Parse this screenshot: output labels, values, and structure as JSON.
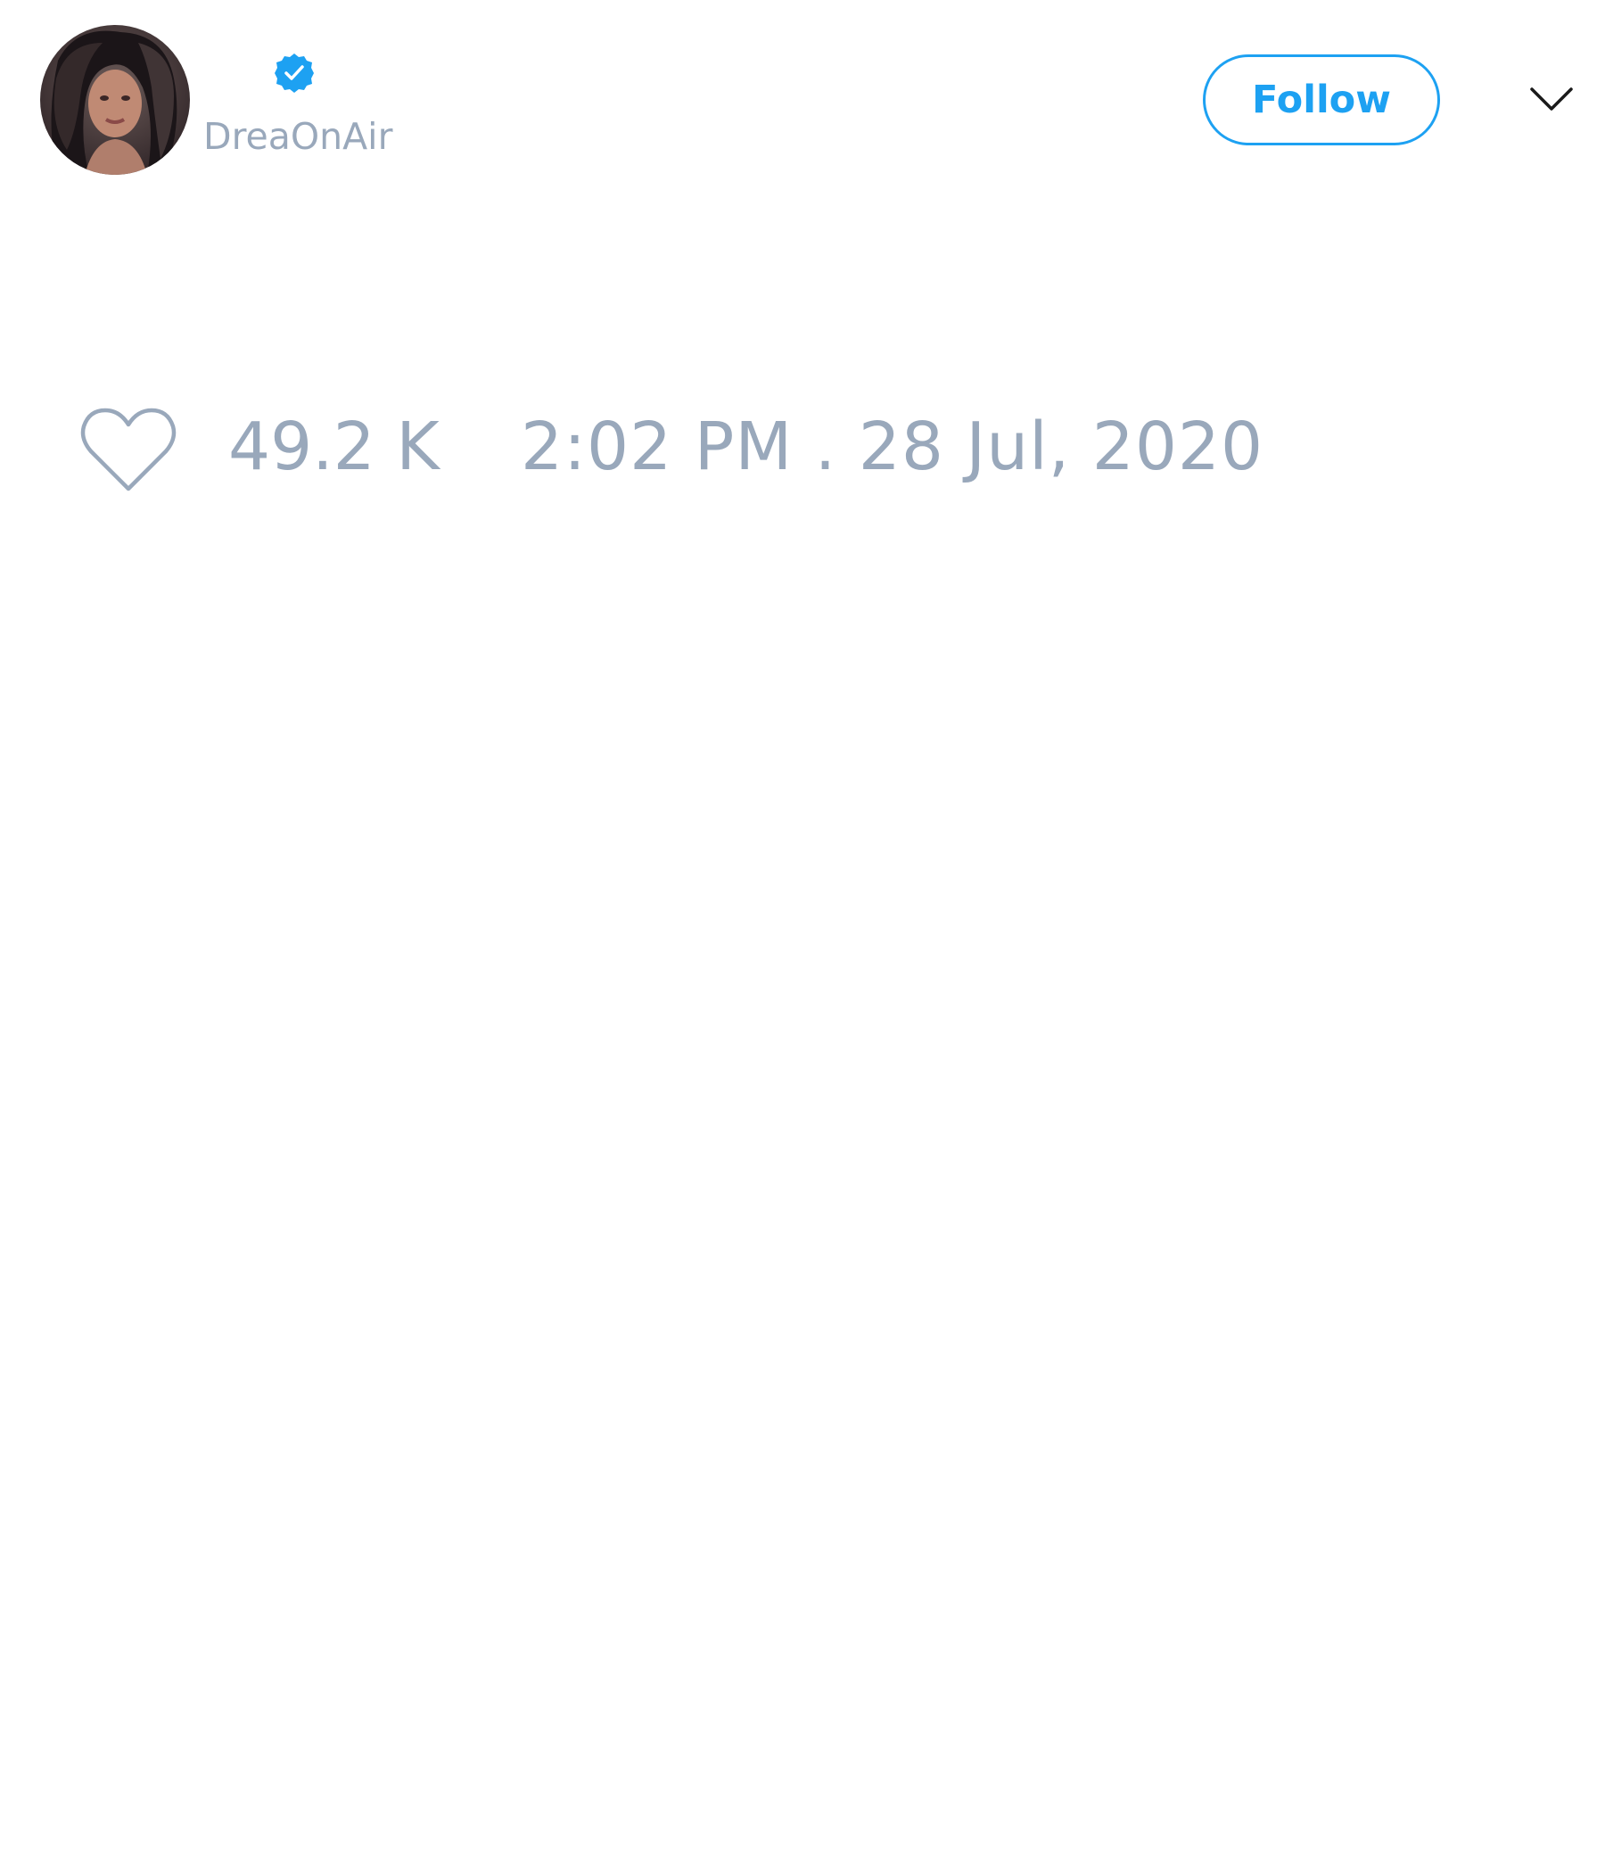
{
  "user": {
    "handle": "DreaOnAir",
    "verified": true,
    "avatar_icon": "profile-photo"
  },
  "header": {
    "follow_label": "Follow",
    "menu_icon": "chevron-down-icon"
  },
  "stats": {
    "like_icon": "heart-outline-icon",
    "likes": "49.2 K",
    "timestamp": "2:02 PM . 28 Jul, 2020"
  },
  "colors": {
    "accent": "#1da1f2",
    "muted_text": "#99a8bb",
    "background": "#ffffff"
  }
}
